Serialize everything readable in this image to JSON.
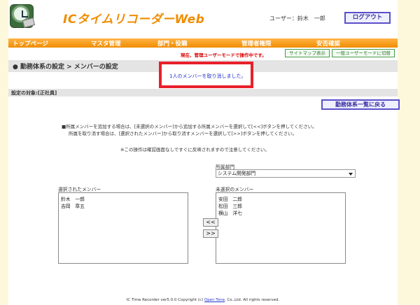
{
  "header": {
    "app_title": "ICタイムリコーダーWeb",
    "user_label": "ユーザー：鈴木　一郎",
    "logout_label": "ログアウト"
  },
  "nav": {
    "items": [
      "トップページ",
      "マスタ管理",
      "部門・役職",
      "管理者権限",
      "安否確認"
    ]
  },
  "mode": {
    "message": "現在、管理ユーザーモードで操作中です。",
    "sitemap_label": "サイトマップ表示",
    "switch_label": "一般ユーザーモードに切替"
  },
  "section": {
    "title": "● 勤務体系の設定 > メンバーの設定",
    "notice": "1人のメンバーを取り消しました。"
  },
  "target": {
    "label": "設定の対象:[正社員]"
  },
  "back_button": "勤務体系一覧に戻る",
  "info": {
    "line1": "■所属メンバーを追加する場合は、[未選択のメンバー]から追加する所属メンバーを選択して[<<]ボタンを押してください。",
    "line2": "所属を取り消す場合は、[選択されたメンバー]から取り消すメンバーを選択して[>>]ボタンを押してください。",
    "line3": "※この操作は確認画面なしですぐに反映されますので注意してください。"
  },
  "department": {
    "label": "所属部門",
    "selected": "システム開発部門"
  },
  "selected_members": {
    "label": "選択されたメンバー",
    "items": [
      "鈴木　一郎",
      "吉岡　章五"
    ]
  },
  "unselected_members": {
    "label": "未選択のメンバー",
    "items": [
      "安田　二郎",
      "松田　三郎",
      "横山　洋七"
    ]
  },
  "buttons": {
    "add": "<<",
    "remove": ">>"
  },
  "footer": {
    "text_before": "IC Time Recorder ver5.0.0 Copyright (c)",
    "link": "Open Tone",
    "text_after": ", Co.,Ltd. All rights reserved."
  },
  "colors": {
    "accent": "#f08c00",
    "button_border": "#5b4fc8",
    "alert": "#e8202a"
  }
}
